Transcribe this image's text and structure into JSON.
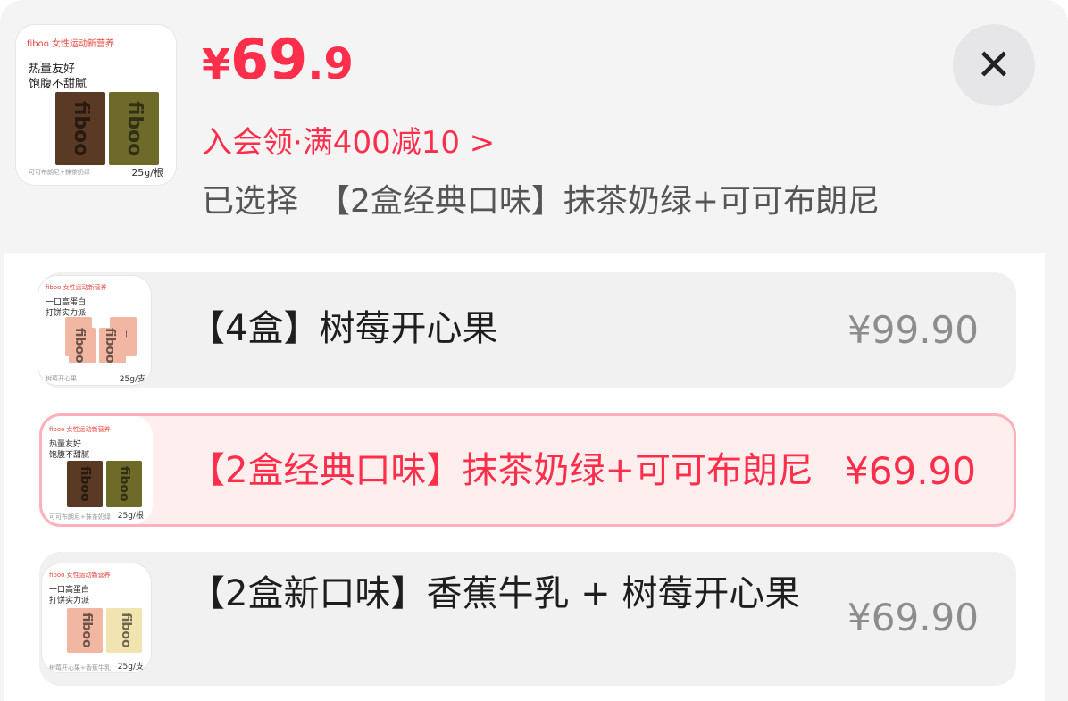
{
  "header": {
    "thumb": {
      "brand": "fiboo 女性运动新营养",
      "tag1": "热量友好",
      "tag2": "饱腹不甜腻",
      "size": "25g/根",
      "fine": "可可布朗尼+抹茶奶绿"
    },
    "price": {
      "yen": "¥",
      "int": "69",
      "dec": ".9"
    },
    "promo": "入会领·满400减10 >",
    "selected_label": "已选择",
    "selected_value": "【2盒经典口味】抹茶奶绿+可可布朗尼",
    "close_icon": "close-icon"
  },
  "options": [
    {
      "label": "【4盒】树莓开心果",
      "price": "¥99.90",
      "selected": false,
      "thumb": {
        "brand": "fiboo 女性运动新营养",
        "tag1": "一口高蛋白",
        "tag2": "打饼实力派",
        "size": "25g/支",
        "fine": "树莓开心果"
      }
    },
    {
      "label": "【2盒经典口味】抹茶奶绿+可可布朗尼",
      "price": "¥69.90",
      "selected": true,
      "thumb": {
        "brand": "fiboo 女性运动新营养",
        "tag1": "热量友好",
        "tag2": "饱腹不甜腻",
        "size": "25g/根",
        "fine": "可可布朗尼+抹茶奶绿"
      }
    },
    {
      "label": "【2盒新口味】香蕉牛乳 + 树莓开心果",
      "price": "¥69.90",
      "selected": false,
      "thumb": {
        "brand": "fiboo 女性运动新营养",
        "tag1": "一口高蛋白",
        "tag2": "打饼实力派",
        "size": "25g/支",
        "fine": "树莓开心果+香蕉牛乳"
      }
    }
  ],
  "colors": {
    "accent": "#ff2e4a",
    "selected_bg": "#ffeeee",
    "selected_border": "#ffb1bb",
    "option_bg": "#f1f1f2"
  }
}
